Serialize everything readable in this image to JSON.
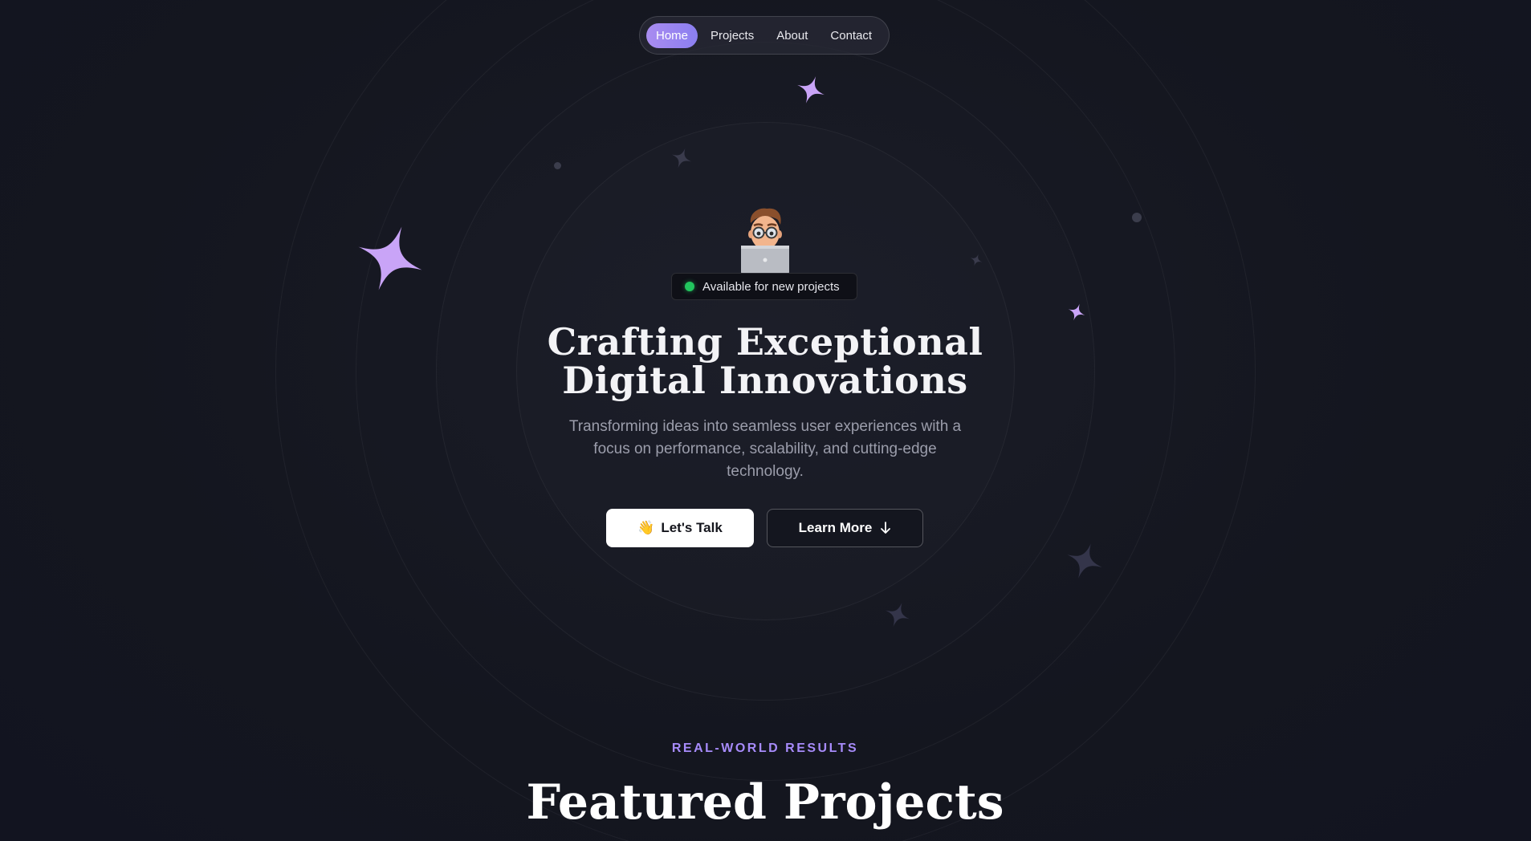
{
  "nav": {
    "items": [
      {
        "label": "Home",
        "active": true
      },
      {
        "label": "Projects",
        "active": false
      },
      {
        "label": "About",
        "active": false
      },
      {
        "label": "Contact",
        "active": false
      }
    ]
  },
  "hero": {
    "avatar_icon": "memoji-laptop-avatar",
    "status_badge": "Available for new projects",
    "status_color": "#22c55e",
    "title_line1": "Crafting Exceptional",
    "title_line2": "Digital Innovations",
    "subtitle": "Transforming ideas into seamless user experiences with a focus on performance, scalability, and cutting-edge technology.",
    "primary_button": {
      "emoji": "👋",
      "label": "Let's Talk"
    },
    "secondary_button": {
      "label": "Learn More",
      "icon": "arrow-down-icon"
    }
  },
  "featured": {
    "eyebrow": "REAL-WORLD RESULTS",
    "title": "Featured Projects"
  },
  "colors": {
    "background": "#14161f",
    "accent": "#a78bfa",
    "star_accent": "#c9a4f7"
  }
}
